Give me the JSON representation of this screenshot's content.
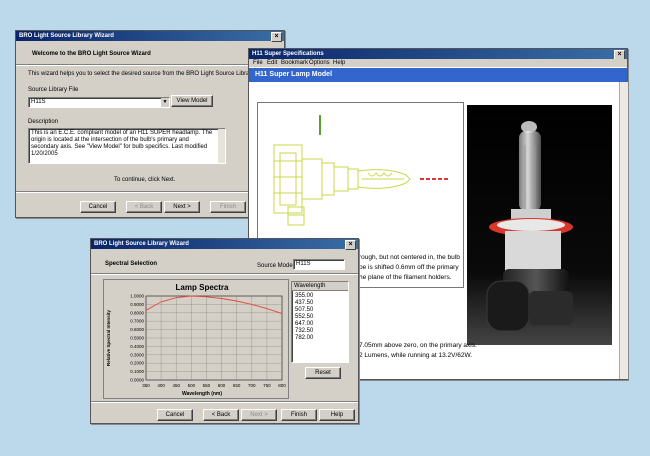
{
  "wizard1": {
    "title": "BRO Light Source Library Wizard",
    "heading": "Welcome to the BRO Light Source Wizard",
    "intro": "This wizard helps you to select the desired source from the BRO Light Source Library.",
    "source_label": "Source Library File",
    "source_value": "H11S",
    "view_model": "View Model",
    "desc_label": "Description",
    "description": "This is an E.C.E. compliant model of an H11 SUPER headlamp. The origin is located at the intersection of the bulb's primary and secondary axis. See \"View Model\" for bulb specifics. Last modified 1/20/2005",
    "continue_text": "To continue, click Next.",
    "buttons": {
      "cancel": "Cancel",
      "back": "< Back",
      "next": "Next >",
      "finish": "Finish"
    }
  },
  "specs": {
    "title": "H11 Super Specifications",
    "menu": [
      "File",
      "Edit",
      "Bookmark",
      "Options",
      "Help"
    ],
    "banner": "H11 Super Lamp Model",
    "text_lines": [
      "rough, but not centered in, the bulb",
      "pe is shifted 0.6mm off the primary",
      "he plane of the filament holders.",
      "7.05mm above zero, on the primary axis.",
      "2 Lumens, while running at 13.2V/62W."
    ]
  },
  "wizard2": {
    "title": "BRO Light Source Library Wizard",
    "heading": "Spectral Selection",
    "source_model_label": "Source Model:",
    "source_model_value": "H11S",
    "wl_header": "Wavelength",
    "wavelengths": [
      "355.00",
      "437.50",
      "507.50",
      "552.50",
      "647.00",
      "732.50",
      "782.00"
    ],
    "reset": "Reset",
    "buttons": {
      "cancel": "Cancel",
      "back": "< Back",
      "next": "Next >",
      "finish": "Finish",
      "help": "Help"
    }
  },
  "chart_data": {
    "type": "line",
    "title": "Lamp Spectra",
    "xlabel": "Wavelength (nm)",
    "ylabel": "Relative Spectral Intensity",
    "xlim": [
      350,
      800
    ],
    "ylim": [
      0,
      1
    ],
    "x_ticks": [
      "350",
      "400",
      "450",
      "500",
      "550",
      "600",
      "650",
      "700",
      "750",
      "800"
    ],
    "y_ticks": [
      "0.0000",
      "0.1000",
      "0.2000",
      "0.3000",
      "0.4000",
      "0.5000",
      "0.6000",
      "0.7000",
      "0.8000",
      "0.9000",
      "1.0000"
    ],
    "grid": true,
    "series": [
      {
        "x": [
          350,
          400,
          450,
          500,
          550,
          600,
          650,
          700,
          750,
          800
        ],
        "y": [
          0.83,
          0.93,
          0.98,
          1.0,
          0.99,
          0.97,
          0.94,
          0.9,
          0.85,
          0.79
        ],
        "color": "#e8453c"
      }
    ]
  }
}
